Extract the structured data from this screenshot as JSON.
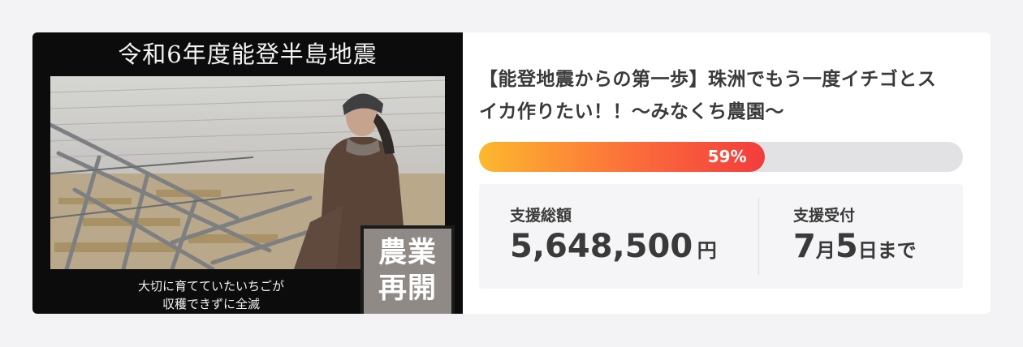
{
  "project": {
    "image": {
      "headline": "令和6年度能登半島地震",
      "caption_line1": "大切に育てていたいちごが",
      "caption_line2": "収穫できずに全滅",
      "stamp_line1": "農業",
      "stamp_line2": "再開"
    },
    "title": "【能登地震からの第一歩】珠洲でもう一度イチゴとスイカ作りたい！！〜みなくち農園〜",
    "progress": {
      "percent": 59,
      "label": "59%"
    },
    "total": {
      "label": "支援総額",
      "amount": "5,648,500",
      "unit": "円"
    },
    "deadline": {
      "label": "支援受付",
      "month": "7",
      "month_unit": "月",
      "day": "5",
      "day_unit": "日まで"
    },
    "colors": {
      "progress_start": "#fdb82e",
      "progress_end": "#f23c3c",
      "track": "#e2e2e4",
      "text": "#3a3a3a"
    }
  }
}
